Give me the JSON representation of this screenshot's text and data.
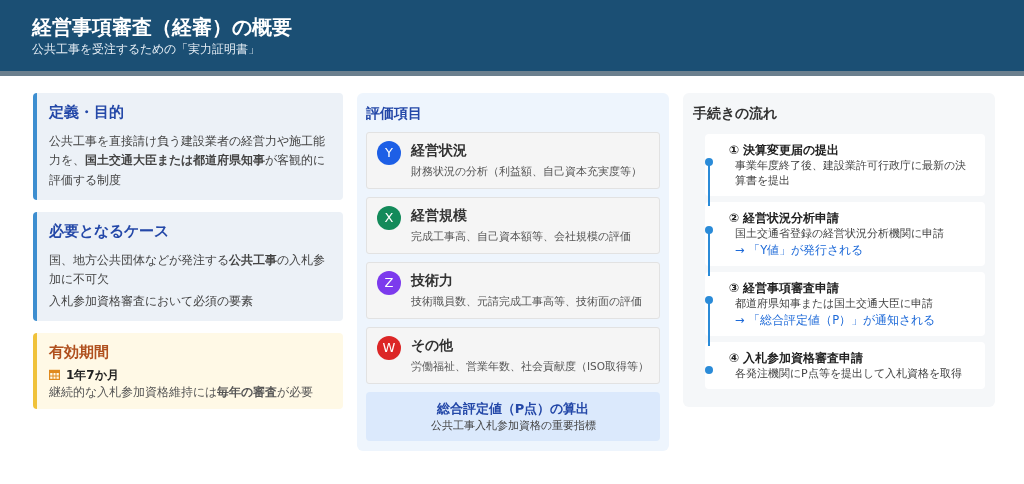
{
  "header": {
    "title": "経営事項審査（経審）の概要",
    "subtitle": "公共工事を受注するための「実力証明書」"
  },
  "info_cards": [
    {
      "kind": "info",
      "title": "定義・目的",
      "paragraphs": [
        "公共工事を直接請け負う建設業者の経営力や施工能力を、**国土交通大臣または都道府県知事**が客観的に評価する制度"
      ]
    },
    {
      "kind": "info",
      "title": "必要となるケース",
      "paragraphs": [
        "国、地方公共団体などが発注する**公共工事**の入札参加に不可欠",
        "入札参加資格審査において必須の要素"
      ]
    },
    {
      "kind": "period",
      "title": "有効期間",
      "period": "1年7か月",
      "note": "継続的な入札参加資格維持には**毎年の審査**が必要"
    }
  ],
  "evaluation": {
    "title": "評価項目",
    "items": [
      {
        "letter": "Y",
        "color": "#1d5fe6",
        "name": "経営状況",
        "description": "財務状況の分析（利益額、自己資本充実度等）"
      },
      {
        "letter": "X",
        "color": "#138a5a",
        "name": "経営規模",
        "description": "完成工事高、自己資本額等、会社規模の評価"
      },
      {
        "letter": "Z",
        "color": "#7c3aed",
        "name": "技術力",
        "description": "技術職員数、元請完成工事高等、技術面の評価"
      },
      {
        "letter": "W",
        "color": "#dc2626",
        "name": "その他",
        "description": "労働福祉、営業年数、社会貢献度（ISO取得等）"
      }
    ],
    "total": {
      "title": "総合評定値（P点）の算出",
      "subtitle": "公共工事入札参加資格の重要指標"
    }
  },
  "procedure": {
    "title": "手続きの流れ",
    "steps": [
      {
        "title": "① 決算変更届の提出",
        "description": "事業年度終了後、建設業許可行政庁に最新の決算書を提出"
      },
      {
        "title": "② 経営状況分析申請",
        "description": "国土交通省登録の経営状況分析機関に申請",
        "result": "→ 「Y値」が発行される"
      },
      {
        "title": "③ 経営事項審査申請",
        "description": "都道府県知事または国土交通大臣に申請",
        "result": "→ 「総合評定値（P）」が通知される"
      },
      {
        "title": "④ 入札参加資格審査申請",
        "description": "各発注機関にP点等を提出して入札資格を取得"
      }
    ]
  }
}
